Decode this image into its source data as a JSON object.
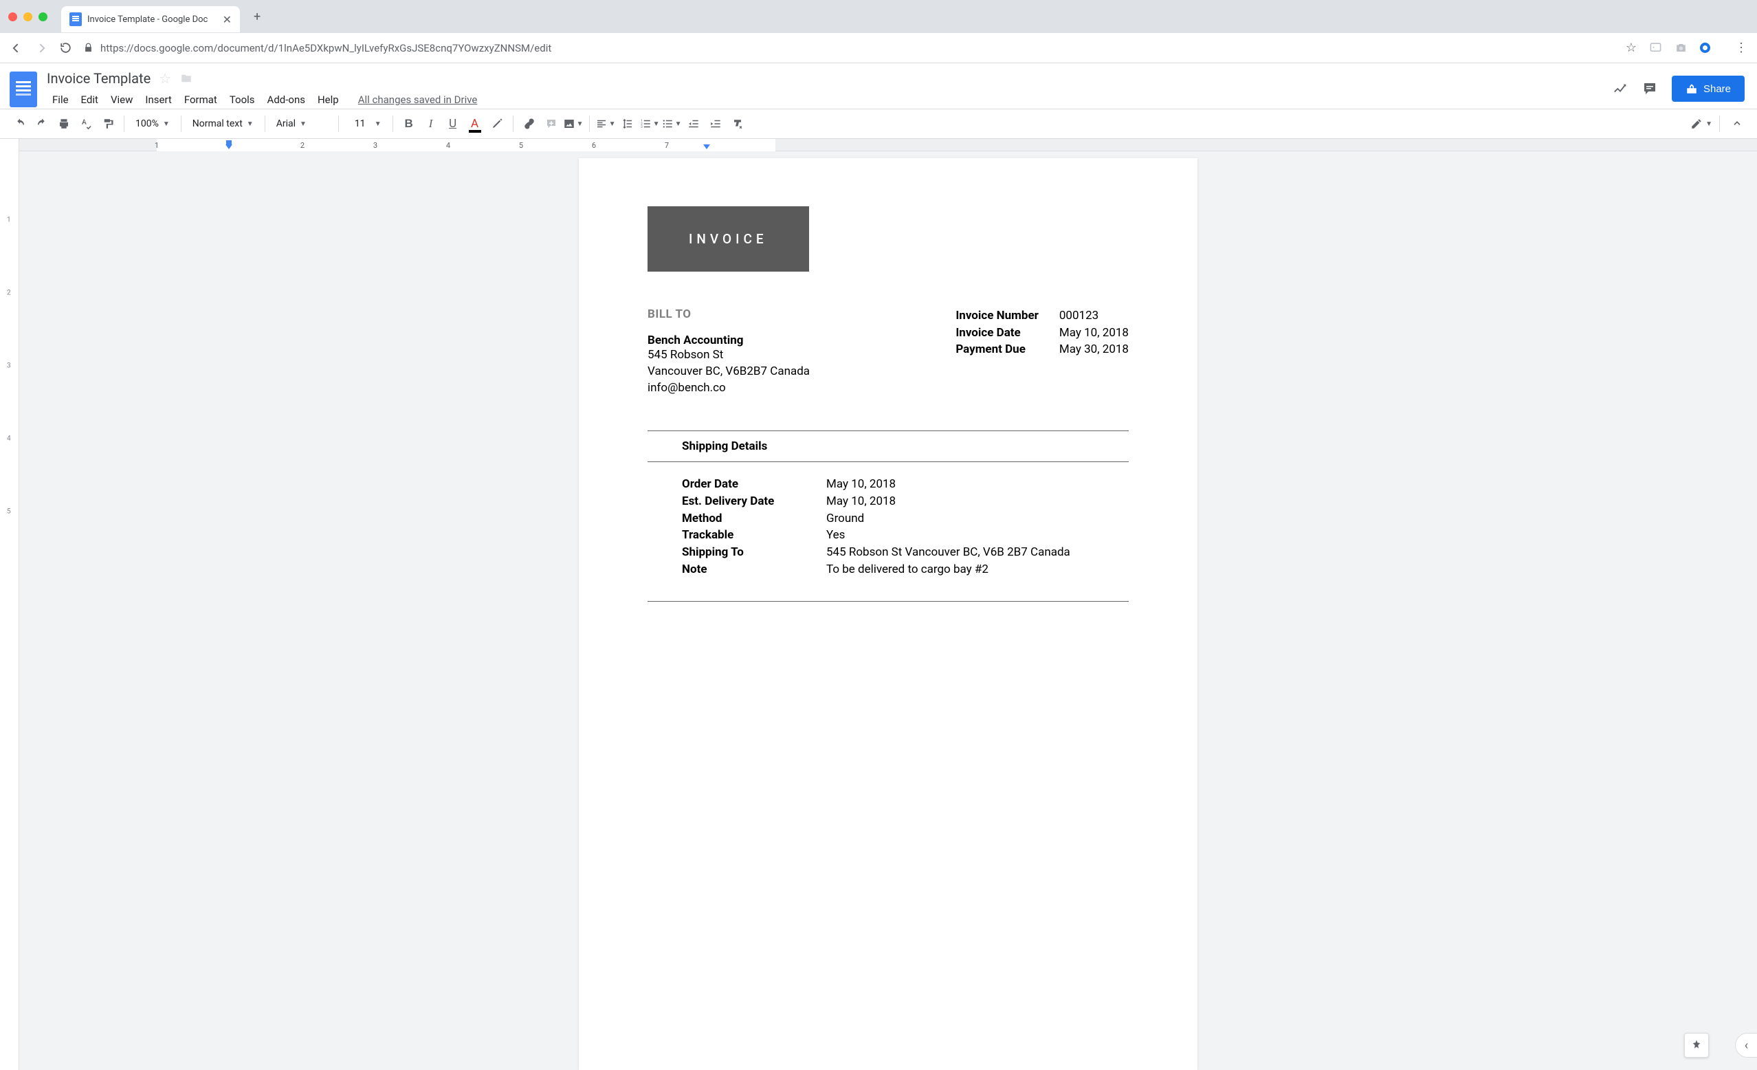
{
  "browser": {
    "tab_title": "Invoice Template - Google Doc",
    "url": "https://docs.google.com/document/d/1lnAe5DXkpwN_lyILvefyRxGsJSE8cnq7YOwzxyZNNSM/edit"
  },
  "docs": {
    "title": "Invoice Template",
    "menus": [
      "File",
      "Edit",
      "View",
      "Insert",
      "Format",
      "Tools",
      "Add-ons",
      "Help"
    ],
    "saved_status": "All changes saved in Drive",
    "share_label": "Share"
  },
  "toolbar": {
    "zoom": "100%",
    "style": "Normal text",
    "font": "Arial",
    "font_size": "11"
  },
  "ruler": {
    "ticks": [
      "1",
      "2",
      "3",
      "4",
      "5",
      "6",
      "7"
    ]
  },
  "invoice": {
    "badge": "INVOICE",
    "bill_to_heading": "BILL TO",
    "company": "Bench Accounting",
    "address1": "545 Robson St",
    "address2": "Vancouver BC, V6B2B7 Canada",
    "email": "info@bench.co",
    "meta": {
      "number_label": "Invoice Number",
      "number": "000123",
      "date_label": "Invoice Date",
      "date": "May 10, 2018",
      "due_label": "Payment Due",
      "due": "May 30, 2018"
    },
    "shipping": {
      "heading": "Shipping Details",
      "order_date_label": "Order Date",
      "order_date": "May 10, 2018",
      "delivery_label": "Est. Delivery Date",
      "delivery": "May 10, 2018",
      "method_label": "Method",
      "method": "Ground",
      "trackable_label": "Trackable",
      "trackable": "Yes",
      "ship_to_label": "Shipping To",
      "ship_to": "545 Robson St Vancouver BC, V6B 2B7 Canada",
      "note_label": "Note",
      "note": "To be delivered to cargo bay #2"
    }
  }
}
